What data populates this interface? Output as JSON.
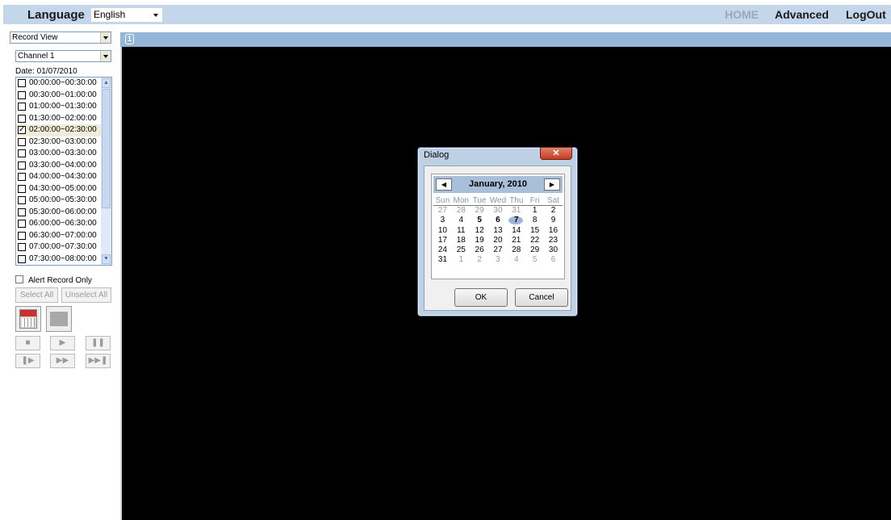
{
  "topbar": {
    "language_label": "Language",
    "language_value": "English",
    "nav_home": "HOME",
    "nav_advanced": "Advanced",
    "nav_logout": "LogOut"
  },
  "left": {
    "view_select": "Record View",
    "channel_select": "Channel 1",
    "date_label": "Date: 01/07/2010",
    "time_slots": [
      {
        "label": "00:00:00~00:30:00",
        "checked": false
      },
      {
        "label": "00:30:00~01:00:00",
        "checked": false
      },
      {
        "label": "01:00:00~01:30:00",
        "checked": false
      },
      {
        "label": "01:30:00~02:00:00",
        "checked": false
      },
      {
        "label": "02:00:00~02:30:00",
        "checked": true
      },
      {
        "label": "02:30:00~03:00:00",
        "checked": false
      },
      {
        "label": "03:00:00~03:30:00",
        "checked": false
      },
      {
        "label": "03:30:00~04:00:00",
        "checked": false
      },
      {
        "label": "04:00:00~04:30:00",
        "checked": false
      },
      {
        "label": "04:30:00~05:00:00",
        "checked": false
      },
      {
        "label": "05:00:00~05:30:00",
        "checked": false
      },
      {
        "label": "05:30:00~06:00:00",
        "checked": false
      },
      {
        "label": "06:00:00~06:30:00",
        "checked": false
      },
      {
        "label": "06:30:00~07:00:00",
        "checked": false
      },
      {
        "label": "07:00:00~07:30:00",
        "checked": false
      },
      {
        "label": "07:30:00~08:00:00",
        "checked": false
      }
    ],
    "alert_record_only": "Alert Record Only",
    "select_all": "Select All",
    "unselect_all": "Unselect All",
    "controls": {
      "stop": "■",
      "play": "▶",
      "pause": "❚❚",
      "step": "❚▶",
      "fast": "▶▶",
      "end": "▶▶❚"
    }
  },
  "video": {
    "channel_number": "1"
  },
  "dialog": {
    "title": "Dialog",
    "close": "✕",
    "month_label": "January, 2010",
    "prev": "◀",
    "next": "▶",
    "weekdays": [
      "Sun",
      "Mon",
      "Tue",
      "Wed",
      "Thu",
      "Fri",
      "Sat"
    ],
    "weeks": [
      [
        "27",
        "28",
        "29",
        "30",
        "31",
        "1",
        "2"
      ],
      [
        "3",
        "4",
        "5",
        "6",
        "7",
        "8",
        "9"
      ],
      [
        "10",
        "11",
        "12",
        "13",
        "14",
        "15",
        "16"
      ],
      [
        "17",
        "18",
        "19",
        "20",
        "21",
        "22",
        "23"
      ],
      [
        "24",
        "25",
        "26",
        "27",
        "28",
        "29",
        "30"
      ],
      [
        "31",
        "1",
        "2",
        "3",
        "4",
        "5",
        "6"
      ]
    ],
    "ok": "OK",
    "cancel": "Cancel"
  }
}
